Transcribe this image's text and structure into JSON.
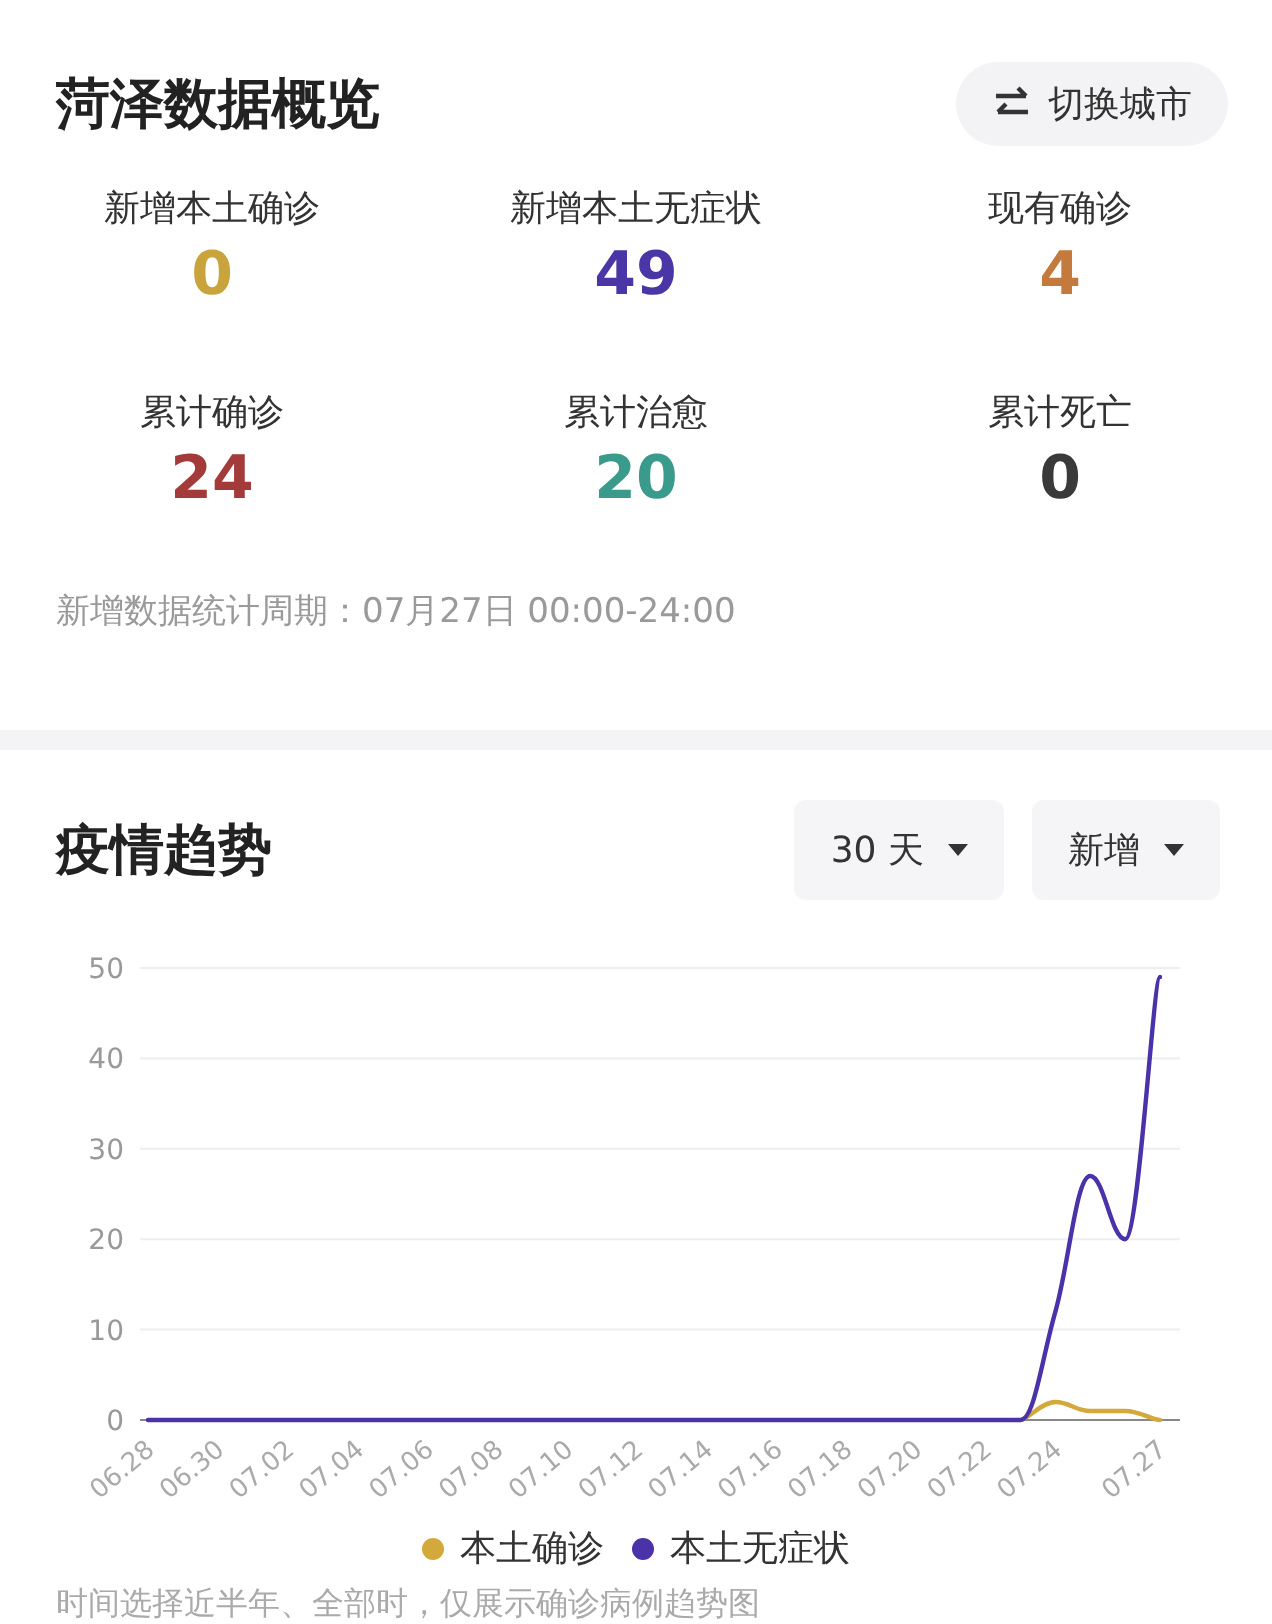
{
  "overview": {
    "title": "菏泽数据概览",
    "switch_button": "切换城市",
    "stats": [
      {
        "label": "新增本土确诊",
        "value": "0",
        "color": "#c9a43c"
      },
      {
        "label": "新增本土无症状",
        "value": "49",
        "color": "#4b36a6"
      },
      {
        "label": "现有确诊",
        "value": "4",
        "color": "#c47a3c"
      },
      {
        "label": "累计确诊",
        "value": "24",
        "color": "#a33b3b"
      },
      {
        "label": "累计治愈",
        "value": "20",
        "color": "#3a9a8c"
      },
      {
        "label": "累计死亡",
        "value": "0",
        "color": "#3a3a3a"
      }
    ],
    "footnote": "新增数据统计周期：07月27日 00:00-24:00"
  },
  "trend": {
    "title": "疫情趋势",
    "dropdowns": [
      {
        "label": "30 天"
      },
      {
        "label": "新增"
      }
    ],
    "chart_data": {
      "type": "line",
      "categories": [
        "06.28",
        null,
        "06.30",
        null,
        "07.02",
        null,
        "07.04",
        null,
        "07.06",
        null,
        "07.08",
        null,
        "07.10",
        null,
        "07.12",
        null,
        "07.14",
        null,
        "07.16",
        null,
        "07.18",
        null,
        "07.20",
        null,
        "07.22",
        null,
        "07.24",
        null,
        null,
        "07.27"
      ],
      "series": [
        {
          "name": "本土确诊",
          "color": "#d4a83a",
          "values": [
            null,
            null,
            null,
            null,
            null,
            null,
            null,
            null,
            null,
            null,
            null,
            null,
            null,
            null,
            null,
            null,
            null,
            null,
            null,
            null,
            null,
            null,
            null,
            null,
            null,
            0,
            2,
            1,
            1,
            0
          ]
        },
        {
          "name": "本土无症状",
          "color": "#4a32a8",
          "values": [
            0,
            0,
            0,
            0,
            0,
            0,
            0,
            0,
            0,
            0,
            0,
            0,
            0,
            0,
            0,
            0,
            0,
            0,
            0,
            0,
            0,
            0,
            0,
            0,
            0,
            0,
            12,
            27,
            20,
            49
          ]
        }
      ],
      "ylim": [
        0,
        50
      ],
      "yticks": [
        0,
        10,
        20,
        30,
        40,
        50
      ],
      "grid": true
    },
    "note": "时间选择近半年、全部时，仅展示确诊病例趋势图"
  }
}
